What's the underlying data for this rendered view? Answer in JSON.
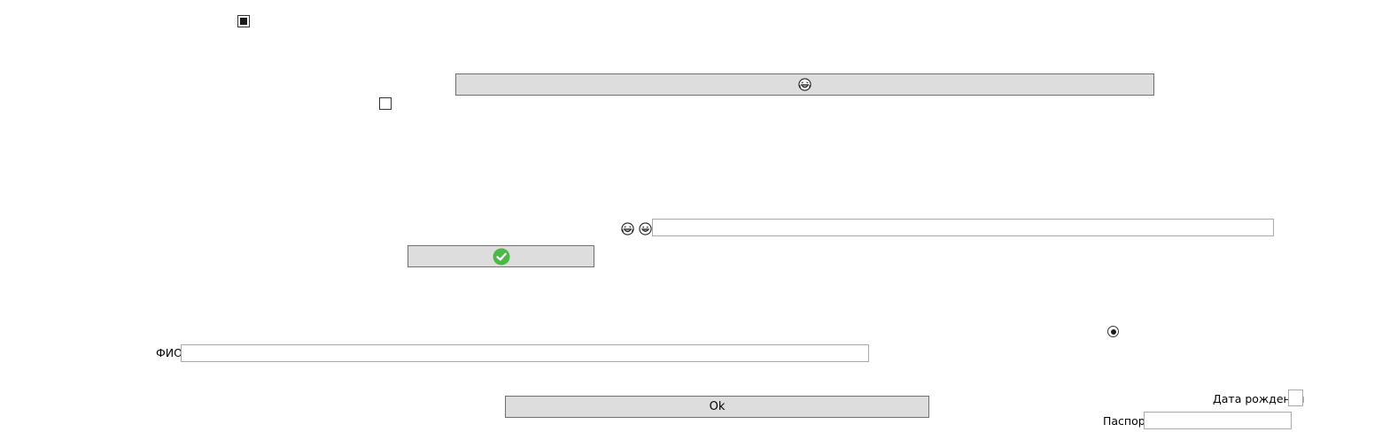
{
  "checkbox_top": {
    "state": "indeterminate"
  },
  "checkbox_second": {
    "state": "unchecked"
  },
  "emoji_button": {
    "icon": "laughing-face-icon"
  },
  "emoji_row": {
    "icons": [
      "laughing-face-icon",
      "grinning-face-icon"
    ],
    "input_value": ""
  },
  "confirm_button": {
    "icon": "green-check-icon",
    "icon_color": "#4cb848"
  },
  "radio": {
    "selected": true
  },
  "fio": {
    "label": "ФИО",
    "value": ""
  },
  "ok_button": {
    "label": "Ok"
  },
  "birth_date": {
    "label": "Дата рождения",
    "state": "unchecked"
  },
  "passport": {
    "label": "Паспорт",
    "value": ""
  }
}
